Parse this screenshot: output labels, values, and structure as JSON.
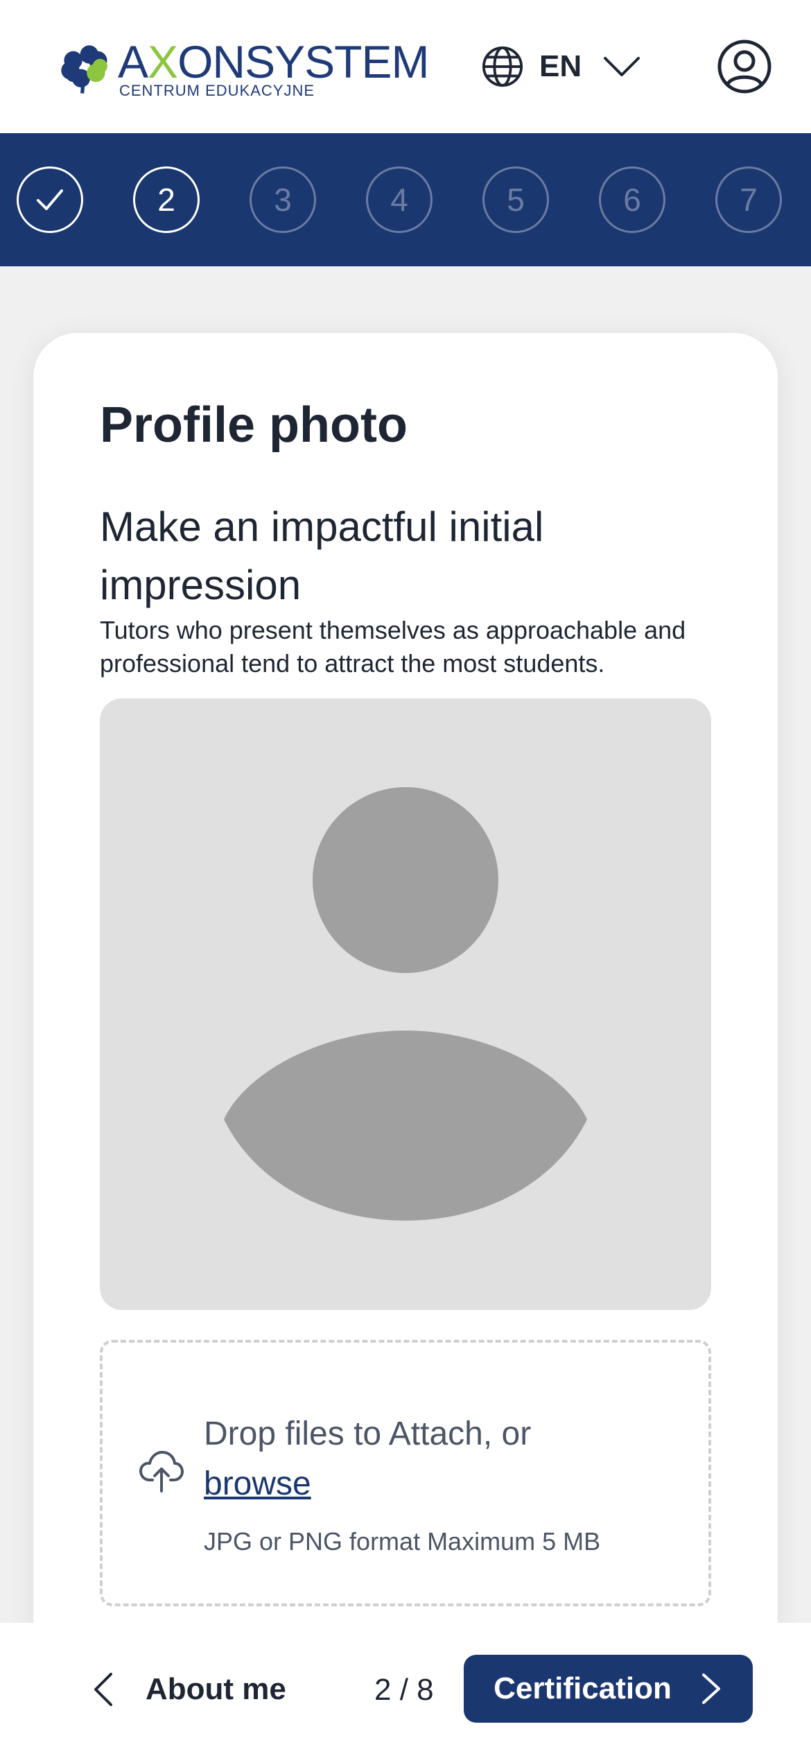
{
  "header": {
    "brand_part1_a": "A",
    "brand_part1_x": "X",
    "brand_part1_on": "ON",
    "brand_part2": "SYSTEM",
    "brand_subtitle": "CENTRUM  EDUKACYJNE",
    "language": "EN"
  },
  "stepper": {
    "steps": [
      {
        "label": "",
        "state": "completed"
      },
      {
        "label": "2",
        "state": "current"
      },
      {
        "label": "3",
        "state": "upcoming"
      },
      {
        "label": "4",
        "state": "upcoming"
      },
      {
        "label": "5",
        "state": "upcoming"
      },
      {
        "label": "6",
        "state": "upcoming"
      },
      {
        "label": "7",
        "state": "upcoming"
      }
    ]
  },
  "card": {
    "title": "Profile photo",
    "heading": "Make an impactful initial impression",
    "description": "Tutors who present themselves as approachable and professional tend to attract the most students."
  },
  "upload": {
    "prompt": "Drop files to Attach, or",
    "browse_label": "browse",
    "hint": "JPG or PNG format Maximum 5 MB"
  },
  "footer": {
    "back_label": "About me",
    "pager": "2 / 8",
    "next_label": "Certification"
  },
  "colors": {
    "primary": "#1b3770",
    "brand_green": "#8cc63f",
    "background": "#f0f0f0",
    "placeholder_bg": "#e0e0e0",
    "placeholder_figure": "#a0a0a0"
  }
}
